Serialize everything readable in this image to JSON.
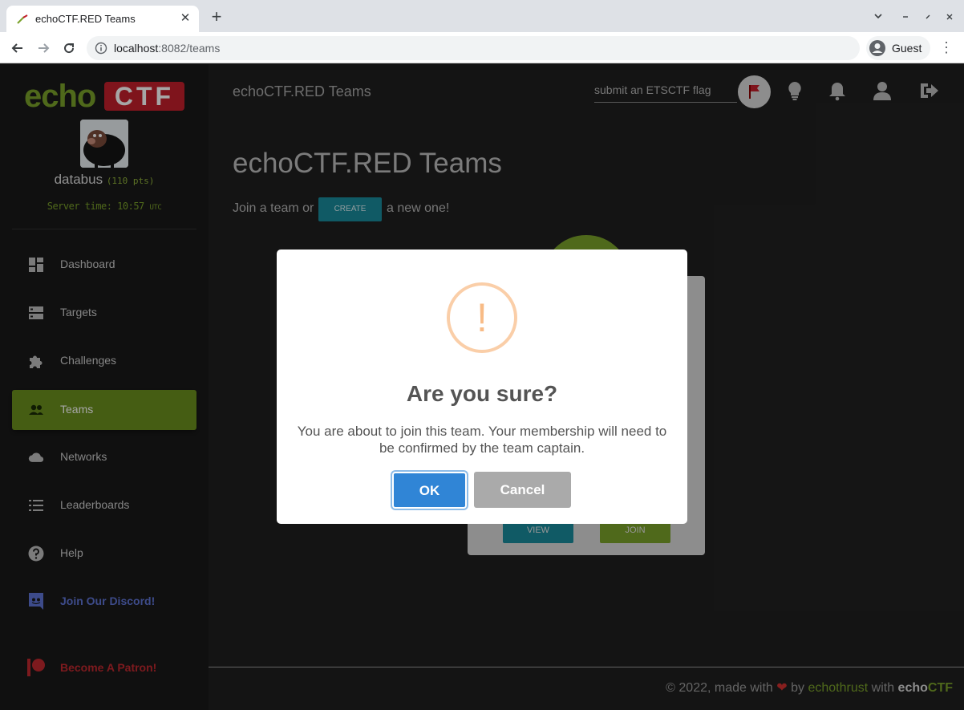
{
  "browser": {
    "tab_title": "echoCTF.RED Teams",
    "new_tab": "+",
    "close_tab": "✕",
    "url_host": "localhost",
    "url_path": ":8082/teams",
    "profile_label": "Guest"
  },
  "sidebar": {
    "logo_echo": "echo",
    "logo_ctf": "CTF",
    "username": "databus",
    "points": "(110 pts)",
    "server_time_label": "Server time: 10:57",
    "server_time_tz": "UTC",
    "items": [
      {
        "label": "Dashboard",
        "icon": "dashboard-icon"
      },
      {
        "label": "Targets",
        "icon": "server-icon"
      },
      {
        "label": "Challenges",
        "icon": "puzzle-icon"
      },
      {
        "label": "Teams",
        "icon": "people-icon"
      },
      {
        "label": "Networks",
        "icon": "cloud-icon"
      },
      {
        "label": "Leaderboards",
        "icon": "list-icon"
      },
      {
        "label": "Help",
        "icon": "help-icon"
      },
      {
        "label": "Join Our Discord!",
        "icon": "discord-icon"
      },
      {
        "label": "Become A Patron!",
        "icon": "patreon-icon"
      }
    ]
  },
  "header": {
    "title": "echoCTF.RED Teams",
    "flag_placeholder": "submit an ETSCTF flag"
  },
  "main": {
    "page_title": "echoCTF.RED Teams",
    "join_text_before": "Join a team or",
    "create_label": "CREATE",
    "join_text_after": "a new one!",
    "card_view_label": "VIEW",
    "card_join_label": "JOIN"
  },
  "footer": {
    "prefix": "© 2022, made with",
    "by": "by",
    "author": "echothrust",
    "with": "with",
    "brand_echo": "echo",
    "brand_ctf": "CTF"
  },
  "modal": {
    "icon_char": "!",
    "title": "Are you sure?",
    "text": "You are about to join this team. Your membership will need to be confirmed by the team captain.",
    "ok_label": "OK",
    "cancel_label": "Cancel"
  },
  "colors": {
    "brand_green": "#7aa12a",
    "brand_red": "#c31f2b",
    "active_nav": "#6a8f1e",
    "ok_button": "#3085d6",
    "cancel_button": "#aaaaaa",
    "warning": "#f8bb86"
  }
}
